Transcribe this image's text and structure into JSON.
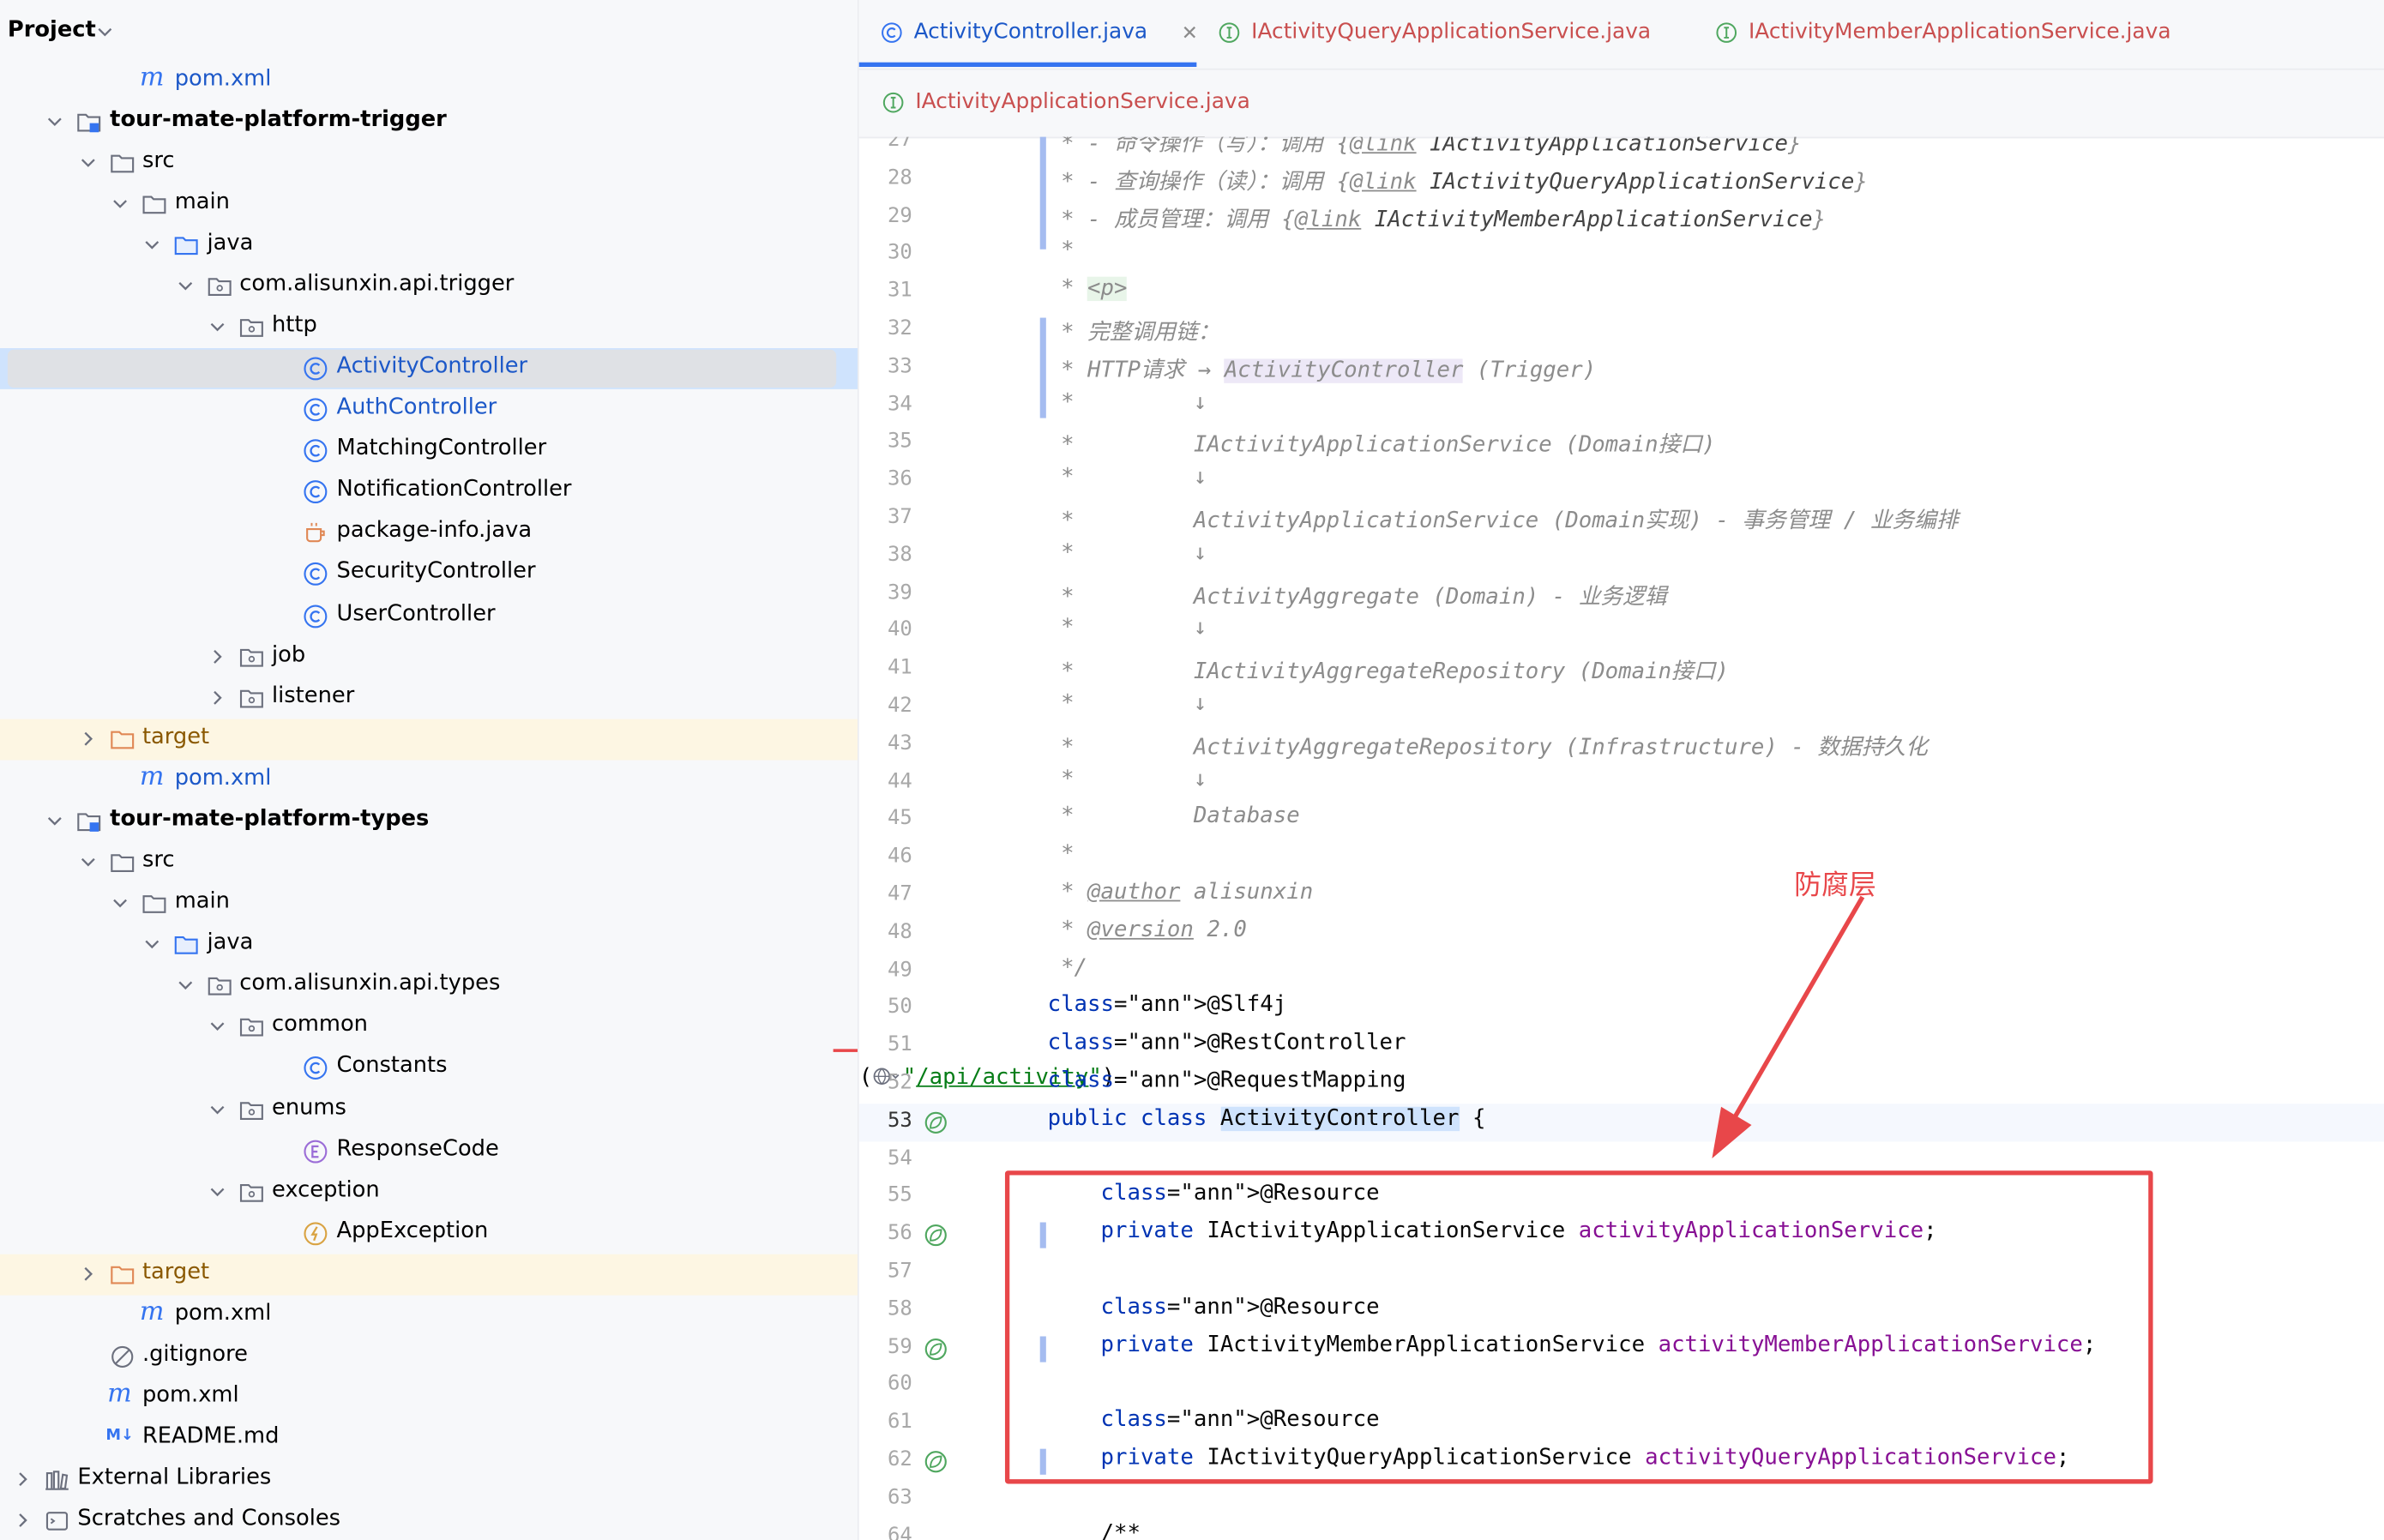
{
  "project": {
    "title": "Project",
    "rows": [
      {
        "label": "pom.xml",
        "type": "maven",
        "highlight": false
      },
      {
        "label": "tour-mate-platform-trigger",
        "type": "module",
        "expanded": true
      },
      {
        "label": "src",
        "type": "folder",
        "expanded": true
      },
      {
        "label": "main",
        "type": "folder",
        "expanded": true
      },
      {
        "label": "java",
        "type": "source-folder",
        "expanded": true
      },
      {
        "label": "com.alisunxin.api.trigger",
        "type": "package",
        "expanded": true
      },
      {
        "label": "http",
        "type": "package",
        "expanded": true
      },
      {
        "label": "ActivityController",
        "type": "class",
        "selected": true
      },
      {
        "label": "AuthController",
        "type": "class"
      },
      {
        "label": "MatchingController",
        "type": "class"
      },
      {
        "label": "NotificationController",
        "type": "class"
      },
      {
        "label": "package-info.java",
        "type": "java-file"
      },
      {
        "label": "SecurityController",
        "type": "class"
      },
      {
        "label": "UserController",
        "type": "class"
      },
      {
        "label": "job",
        "type": "package",
        "expanded": false
      },
      {
        "label": "listener",
        "type": "package",
        "expanded": false
      },
      {
        "label": "target",
        "type": "excluded-folder",
        "expanded": false
      },
      {
        "label": "pom.xml",
        "type": "maven"
      },
      {
        "label": "tour-mate-platform-types",
        "type": "module",
        "expanded": true
      },
      {
        "label": "src",
        "type": "folder",
        "expanded": true
      },
      {
        "label": "main",
        "type": "folder",
        "expanded": true
      },
      {
        "label": "java",
        "type": "source-folder",
        "expanded": true
      },
      {
        "label": "com.alisunxin.api.types",
        "type": "package",
        "expanded": true
      },
      {
        "label": "common",
        "type": "package",
        "expanded": true
      },
      {
        "label": "Constants",
        "type": "class"
      },
      {
        "label": "enums",
        "type": "package",
        "expanded": true
      },
      {
        "label": "ResponseCode",
        "type": "enum"
      },
      {
        "label": "exception",
        "type": "package",
        "expanded": true
      },
      {
        "label": "AppException",
        "type": "exception-class"
      },
      {
        "label": "target",
        "type": "excluded-folder",
        "expanded": false
      },
      {
        "label": "pom.xml",
        "type": "maven"
      },
      {
        "label": ".gitignore",
        "type": "ignore-file"
      },
      {
        "label": "pom.xml",
        "type": "maven"
      },
      {
        "label": "README.md",
        "type": "markdown"
      },
      {
        "label": "External Libraries",
        "type": "libraries",
        "expanded": false
      },
      {
        "label": "Scratches and Consoles",
        "type": "scratches",
        "expanded": false
      }
    ]
  },
  "tabs": [
    {
      "label": "ActivityController.java",
      "icon": "class-icon",
      "active": true
    },
    {
      "label": "IActivityQueryApplicationService.java",
      "icon": "interface-icon"
    },
    {
      "label": "IActivityMemberApplicationService.java",
      "icon": "interface-icon"
    },
    {
      "label": "IActivityApplicationService.java",
      "icon": "interface-icon"
    }
  ],
  "code": {
    "lines": [
      {
        "n": "27",
        "t": " * - 命令操作（写）：调用 {@link IActivityApplicationService}"
      },
      {
        "n": "28",
        "t": " * - 查询操作（读）：调用 {@link IActivityQueryApplicationService}"
      },
      {
        "n": "29",
        "t": " * - 成员管理：调用 {@link IActivityMemberApplicationService}"
      },
      {
        "n": "30",
        "t": " *"
      },
      {
        "n": "31",
        "t": " * <p>"
      },
      {
        "n": "32",
        "t": " * 完整调用链："
      },
      {
        "n": "33",
        "t": " * HTTP请求 → ActivityController (Trigger)"
      },
      {
        "n": "34",
        "t": " *         ↓"
      },
      {
        "n": "35",
        "t": " *         IActivityApplicationService (Domain接口)"
      },
      {
        "n": "36",
        "t": " *         ↓"
      },
      {
        "n": "37",
        "t": " *         ActivityApplicationService (Domain实现) - 事务管理 / 业务编排"
      },
      {
        "n": "38",
        "t": " *         ↓"
      },
      {
        "n": "39",
        "t": " *         ActivityAggregate (Domain) - 业务逻辑"
      },
      {
        "n": "40",
        "t": " *         ↓"
      },
      {
        "n": "41",
        "t": " *         IActivityAggregateRepository (Domain接口)"
      },
      {
        "n": "42",
        "t": " *         ↓"
      },
      {
        "n": "43",
        "t": " *         ActivityAggregateRepository (Infrastructure) - 数据持久化"
      },
      {
        "n": "44",
        "t": " *         ↓"
      },
      {
        "n": "45",
        "t": " *         Database"
      },
      {
        "n": "46",
        "t": " *"
      },
      {
        "n": "47",
        "t": " * @author alisunxin"
      },
      {
        "n": "48",
        "t": " * @version 2.0"
      },
      {
        "n": "49",
        "t": " */"
      },
      {
        "n": "50",
        "t": "@Slf4j"
      },
      {
        "n": "51",
        "t": "@RestController"
      },
      {
        "n": "52",
        "t": "@RequestMapping(\"/api/activity\")"
      },
      {
        "n": "53",
        "t": "public class ActivityController {"
      },
      {
        "n": "54",
        "t": ""
      },
      {
        "n": "55",
        "t": "    @Resource"
      },
      {
        "n": "56",
        "t": "    private IActivityApplicationService activityApplicationService;"
      },
      {
        "n": "57",
        "t": ""
      },
      {
        "n": "58",
        "t": "    @Resource"
      },
      {
        "n": "59",
        "t": "    private IActivityMemberApplicationService activityMemberApplicationService;"
      },
      {
        "n": "60",
        "t": ""
      },
      {
        "n": "61",
        "t": "    @Resource"
      },
      {
        "n": "62",
        "t": "    private IActivityQueryApplicationService activityQueryApplicationService;"
      },
      {
        "n": "63",
        "t": ""
      },
      {
        "n": "64",
        "t": "    /**"
      }
    ]
  },
  "annotation": {
    "label": "防腐层",
    "color": "#e8474a"
  },
  "colors": {
    "accent": "#3574f0",
    "keyword": "#0033b3",
    "annotation": "#9e880d",
    "string": "#067d17",
    "field": "#871094",
    "comment": "#8c8c8c"
  }
}
